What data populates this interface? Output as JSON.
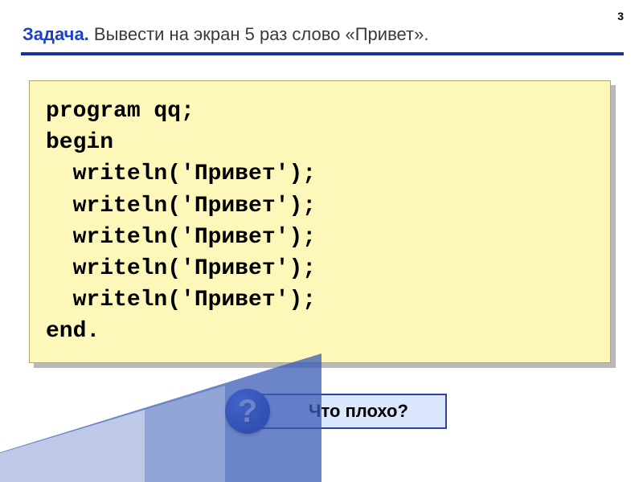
{
  "pageNumber": "3",
  "task": {
    "label": "Задача.",
    "text": " Вывести на экран 5 раз слово «Привет»."
  },
  "code": "program qq;\nbegin\n  writeln('Привет');\n  writeln('Привет');\n  writeln('Привет');\n  writeln('Привет');\n  writeln('Привет');\nend.",
  "question": {
    "symbol": "?",
    "text": "Что плохо?"
  }
}
